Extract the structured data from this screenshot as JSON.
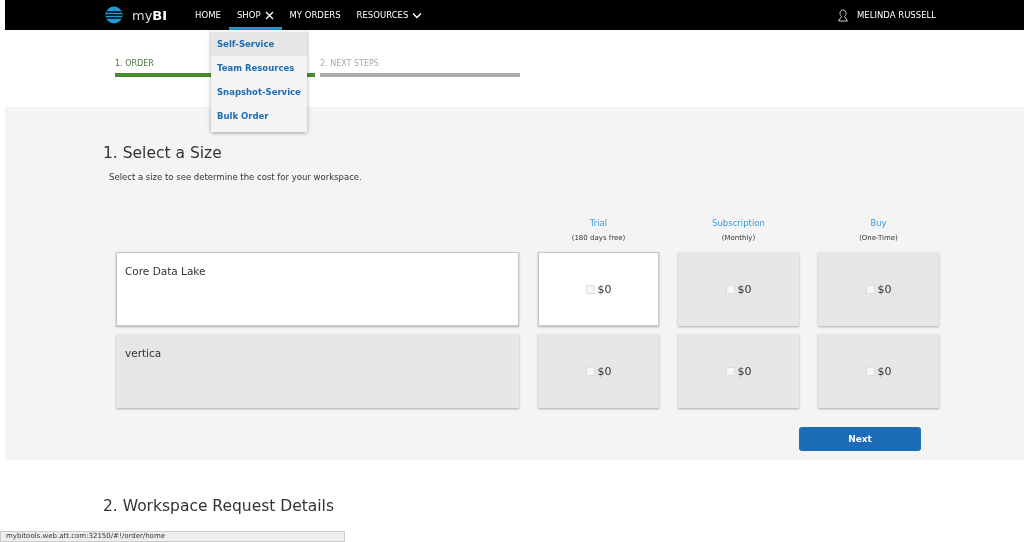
{
  "nav": {
    "logo": "myBI",
    "items": [
      {
        "label": "HOME",
        "selected": false,
        "kind": "plain"
      },
      {
        "label": "SHOP",
        "selected": true,
        "kind": "close"
      },
      {
        "label": "MY ORDERS",
        "selected": false,
        "kind": "plain"
      },
      {
        "label": "RESOURCES",
        "selected": false,
        "kind": "dropdown"
      }
    ],
    "user": "MELINDA RUSSELL"
  },
  "shop_menu": {
    "items": [
      {
        "label": "Self-Service",
        "selected": true
      },
      {
        "label": "Team Resources",
        "selected": false
      },
      {
        "label": "Snapshot-Service",
        "selected": false
      },
      {
        "label": "Bulk Order",
        "selected": false
      }
    ]
  },
  "steps": [
    {
      "label": "1. ORDER",
      "active": true
    },
    {
      "label": "2. NEXT STEPS",
      "active": false
    }
  ],
  "size_section": {
    "title": "1. Select a Size",
    "subtitle": "Select a size to see determine the cost for your workspace.",
    "plans": [
      {
        "name": "Trial",
        "note": "(180 days free)"
      },
      {
        "name": "Subscription",
        "note": "(Monthly)"
      },
      {
        "name": "Buy",
        "note": "(One-Time)"
      }
    ],
    "rows": [
      {
        "name": "Core Data Lake",
        "selected": true,
        "options": [
          {
            "price": "$0",
            "checked": false,
            "selected": true
          },
          {
            "price": "$0",
            "checked": false,
            "selected": false
          },
          {
            "price": "$0",
            "checked": false,
            "selected": false
          }
        ]
      },
      {
        "name": "vertica",
        "selected": false,
        "options": [
          {
            "price": "$0",
            "checked": false,
            "selected": false
          },
          {
            "price": "$0",
            "checked": false,
            "selected": false
          },
          {
            "price": "$0",
            "checked": false,
            "selected": false
          }
        ]
      }
    ],
    "button": "Next"
  },
  "details_section": {
    "title": "2. Workspace Request Details"
  },
  "status_bar": {
    "url": "mybitools.web.att.com:32150/#!/order/home"
  }
}
